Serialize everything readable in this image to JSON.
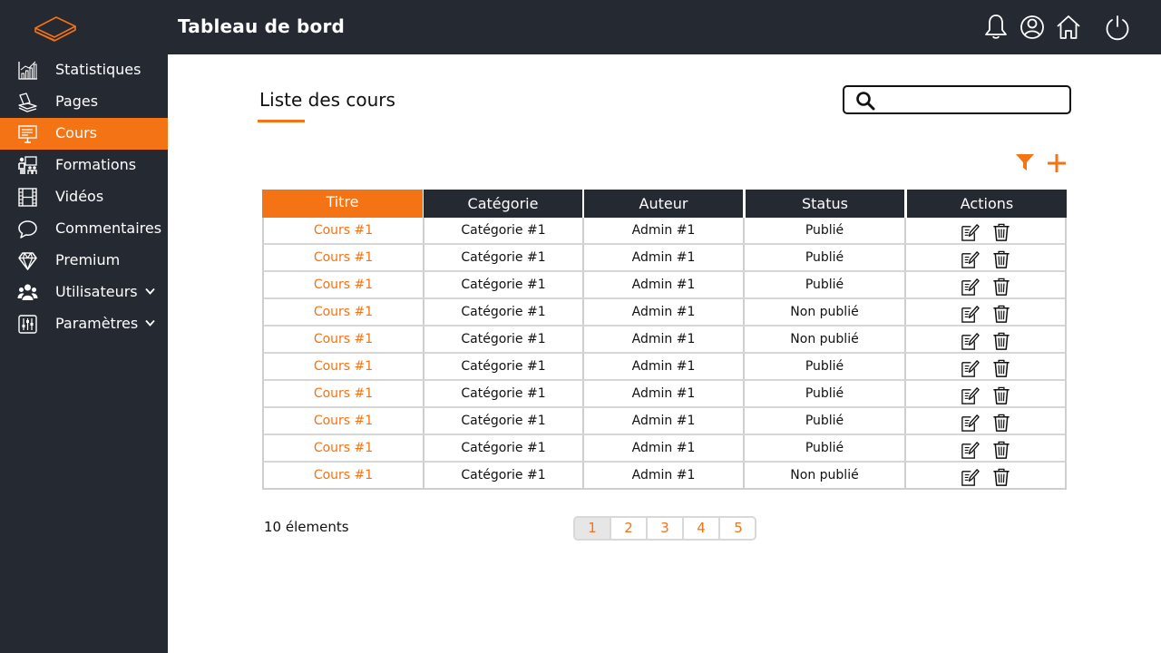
{
  "app": {
    "title": "Tableau de bord"
  },
  "header": {
    "icons": [
      "bell-icon",
      "user-icon",
      "home-icon",
      "power-icon"
    ]
  },
  "colors": {
    "accent": "#f47314",
    "dark": "#252932"
  },
  "sidebar": {
    "items": [
      {
        "label": "Statistiques",
        "icon": "chart-icon",
        "active": false,
        "expandable": false
      },
      {
        "label": "Pages",
        "icon": "pages-icon",
        "active": false,
        "expandable": false
      },
      {
        "label": "Cours",
        "icon": "presentation-icon",
        "active": true,
        "expandable": false
      },
      {
        "label": "Formations",
        "icon": "training-icon",
        "active": false,
        "expandable": false
      },
      {
        "label": "Vidéos",
        "icon": "film-icon",
        "active": false,
        "expandable": false
      },
      {
        "label": "Commentaires",
        "icon": "comment-icon",
        "active": false,
        "expandable": false
      },
      {
        "label": "Premium",
        "icon": "diamond-icon",
        "active": false,
        "expandable": false
      },
      {
        "label": "Utilisateurs",
        "icon": "users-icon",
        "active": false,
        "expandable": true
      },
      {
        "label": "Paramètres",
        "icon": "sliders-icon",
        "active": false,
        "expandable": true
      }
    ]
  },
  "main": {
    "title": "Liste des cours",
    "search": {
      "placeholder": "",
      "value": ""
    },
    "table": {
      "columns": [
        "Titre",
        "Catégorie",
        "Auteur",
        "Status",
        "Actions"
      ],
      "sorted_column": "Titre",
      "rows": [
        {
          "titre": "Cours #1",
          "categorie": "Catégorie #1",
          "auteur": "Admin #1",
          "status": "Publié"
        },
        {
          "titre": "Cours #1",
          "categorie": "Catégorie #1",
          "auteur": "Admin #1",
          "status": "Publié"
        },
        {
          "titre": "Cours #1",
          "categorie": "Catégorie #1",
          "auteur": "Admin #1",
          "status": "Publié"
        },
        {
          "titre": "Cours #1",
          "categorie": "Catégorie #1",
          "auteur": "Admin #1",
          "status": "Non publié"
        },
        {
          "titre": "Cours #1",
          "categorie": "Catégorie #1",
          "auteur": "Admin #1",
          "status": "Non publié"
        },
        {
          "titre": "Cours #1",
          "categorie": "Catégorie #1",
          "auteur": "Admin #1",
          "status": "Publié"
        },
        {
          "titre": "Cours #1",
          "categorie": "Catégorie #1",
          "auteur": "Admin #1",
          "status": "Publié"
        },
        {
          "titre": "Cours #1",
          "categorie": "Catégorie #1",
          "auteur": "Admin #1",
          "status": "Publié"
        },
        {
          "titre": "Cours #1",
          "categorie": "Catégorie #1",
          "auteur": "Admin #1",
          "status": "Publié"
        },
        {
          "titre": "Cours #1",
          "categorie": "Catégorie #1",
          "auteur": "Admin #1",
          "status": "Non publié"
        }
      ],
      "row_actions": [
        "edit-icon",
        "trash-icon"
      ]
    },
    "count_text": "10 élements",
    "pagination": {
      "pages": [
        "1",
        "2",
        "3",
        "4",
        "5"
      ],
      "current": "1"
    }
  }
}
